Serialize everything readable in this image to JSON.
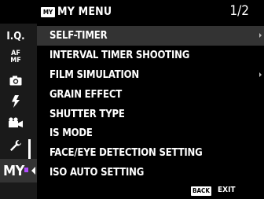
{
  "header": {
    "badge": "MY",
    "title": "MY MENU",
    "page": "1/2"
  },
  "sidebar": {
    "tabs": [
      {
        "name": "iq",
        "label": "I.Q."
      },
      {
        "name": "af-mf",
        "label_top": "AF",
        "label_bottom": "MF"
      },
      {
        "name": "shooting-setting",
        "icon": "camera-icon"
      },
      {
        "name": "flash-setting",
        "icon": "flash-icon"
      },
      {
        "name": "movie-setting",
        "icon": "movie-camera-icon"
      },
      {
        "name": "setup",
        "icon": "wrench-icon"
      }
    ],
    "active_tab": "MY",
    "accent_color": "#b14cff"
  },
  "menu": {
    "items": [
      {
        "label": "SELF-TIMER",
        "submenu": true
      },
      {
        "label": "INTERVAL TIMER SHOOTING",
        "submenu": false
      },
      {
        "label": "FILM SIMULATION",
        "submenu": true
      },
      {
        "label": "GRAIN EFFECT",
        "submenu": false
      },
      {
        "label": "SHUTTER TYPE",
        "submenu": false
      },
      {
        "label": "IS MODE",
        "submenu": false
      },
      {
        "label": "FACE/EYE DETECTION SETTING",
        "submenu": false
      },
      {
        "label": "ISO AUTO SETTING",
        "submenu": false
      }
    ],
    "selected_index": 0
  },
  "footer": {
    "back_button": "BACK",
    "back_action": "EXIT"
  }
}
